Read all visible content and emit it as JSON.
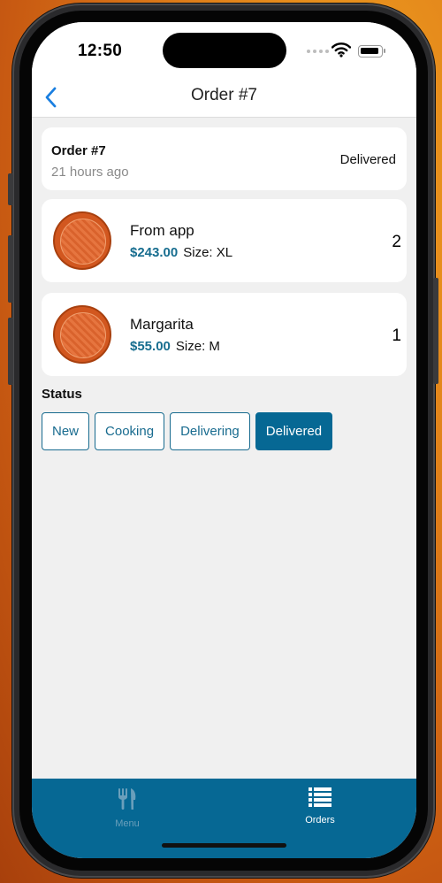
{
  "status_bar": {
    "time": "12:50"
  },
  "nav": {
    "title": "Order #7",
    "back_icon": "chevron-left-icon"
  },
  "order": {
    "title": "Order #7",
    "time_ago": "21 hours ago",
    "status": "Delivered"
  },
  "items": [
    {
      "name": "From app",
      "price": "$243.00",
      "size": "Size: XL",
      "quantity": "2"
    },
    {
      "name": "Margarita",
      "price": "$55.00",
      "size": "Size: M",
      "quantity": "1"
    }
  ],
  "status_section": {
    "label": "Status",
    "options": [
      "New",
      "Cooking",
      "Delivering",
      "Delivered"
    ],
    "selected": "Delivered"
  },
  "tabbar": {
    "tabs": [
      {
        "label": "Menu",
        "icon": "fork-knife-icon",
        "active": false
      },
      {
        "label": "Orders",
        "icon": "list-icon",
        "active": true
      }
    ]
  },
  "colors": {
    "accent": "#066894",
    "price": "#176d8f",
    "tab_inactive": "#6a9fbb"
  }
}
